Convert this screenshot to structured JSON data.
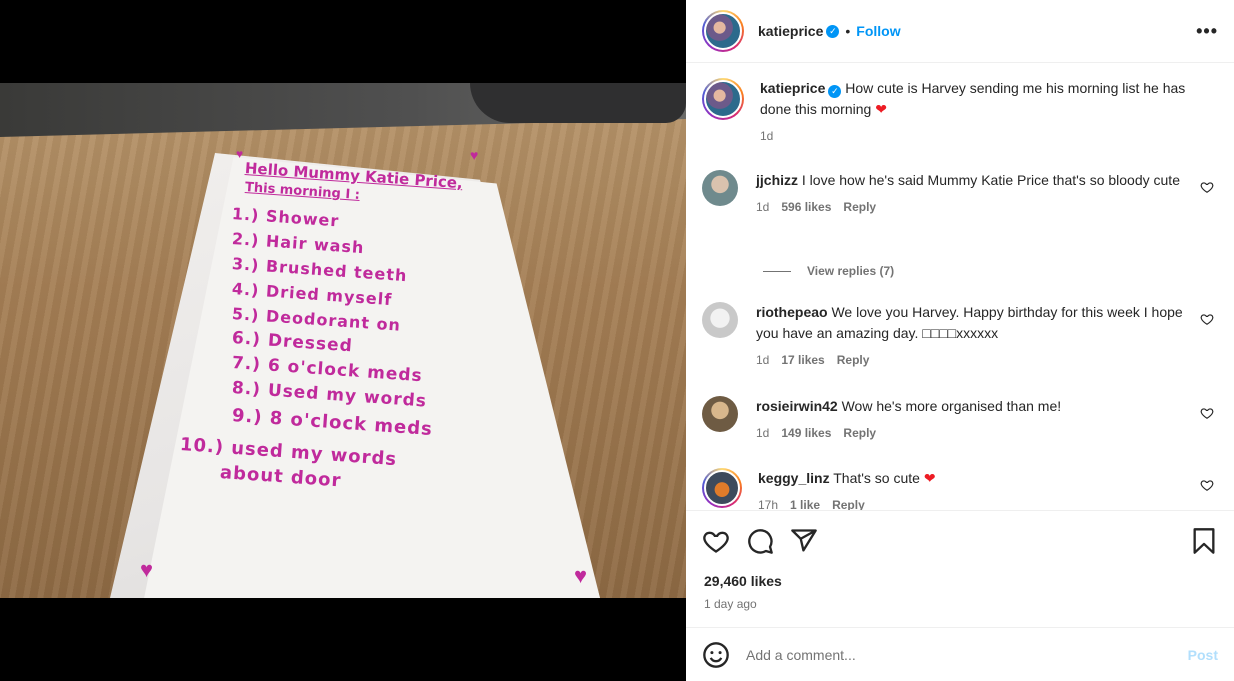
{
  "post": {
    "username": "katieprice",
    "follow_label": "Follow",
    "caption": "How cute is Harvey sending me his morning list he has done this morning",
    "caption_time": "1d",
    "likes": "29,460 likes",
    "posted_ago": "1 day ago"
  },
  "photo_note": {
    "heading": "Hello Mummy Katie Price,",
    "subheading": "This morning I :",
    "items": [
      "1.) Shower",
      "2.) Hair wash",
      "3.) Brushed teeth",
      "4.) Dried myself",
      "5.) Deodorant on",
      "6.) Dressed",
      "7.) 6 o'clock meds",
      "8.) Used my words",
      "9.) 8 o'clock meds",
      "10.) used my words",
      "about door"
    ]
  },
  "comments": [
    {
      "user": "jjchizz",
      "text": "I love how he's said Mummy Katie Price that's so bloody cute",
      "time": "1d",
      "likes": "596 likes",
      "reply": "Reply"
    },
    {
      "user": "riothepeao",
      "text": "We love you Harvey. Happy birthday for this week I hope you have an amazing day. □□□□xxxxxx",
      "time": "1d",
      "likes": "17 likes",
      "reply": "Reply"
    },
    {
      "user": "rosieirwin42",
      "text": "Wow he's more organised than me!",
      "time": "1d",
      "likes": "149 likes",
      "reply": "Reply"
    },
    {
      "user": "keggy_linz",
      "text": "That's so cute",
      "time": "17h",
      "likes": "1 like",
      "reply": "Reply"
    }
  ],
  "view_replies": "View replies (7)",
  "add_comment": {
    "placeholder": "Add a comment...",
    "post_label": "Post"
  },
  "icons": {
    "verified": "verified-badge-icon",
    "more": "more-options-icon",
    "like": "heart-icon",
    "comment": "comment-icon",
    "share": "share-icon",
    "save": "bookmark-icon",
    "emoji": "emoji-icon"
  },
  "colors": {
    "accent": "#0095f6",
    "heart": "#ed1c24",
    "ink": "#c02a9c"
  }
}
